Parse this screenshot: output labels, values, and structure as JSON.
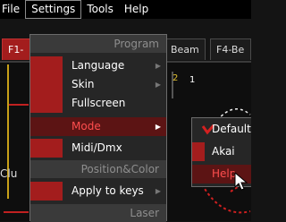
{
  "menubar": {
    "items": [
      {
        "label": "File"
      },
      {
        "label": "Settings"
      },
      {
        "label": "Tools"
      },
      {
        "label": "Help"
      }
    ]
  },
  "app": {
    "tabs": [
      {
        "label": "F1-"
      },
      {
        "label": "Beam"
      },
      {
        "label": "F4-Be"
      }
    ],
    "side_text": "Clu",
    "num1": "2",
    "num2": "1"
  },
  "settings_menu": {
    "header_program": "Program",
    "language": "Language",
    "skin": "Skin",
    "fullscreen": "Fullscreen",
    "mode": "Mode",
    "midi": "Midi/Dmx",
    "header_position": "Position&Color",
    "apply_keys": "Apply to keys",
    "header_laser": "Laser"
  },
  "mode_submenu": {
    "default": "Default",
    "akai": "Akai",
    "help": "Help"
  },
  "colors": {
    "accent_red": "#a31d1d",
    "highlight_red": "#ff4e4e"
  }
}
